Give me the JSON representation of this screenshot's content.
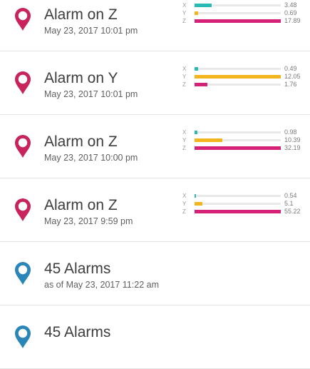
{
  "colors": {
    "alarm_pin": "#c8245a",
    "summary_pin": "#2a86b8",
    "x_bar": "#2ab9b5",
    "y_bar": "#f2b51d",
    "z_bar": "#d62179",
    "track": "#e9e9e9"
  },
  "rows": [
    {
      "type": "alarm",
      "icon": "map-pin-icon",
      "title": "Alarm on Z",
      "timestamp": "May 23, 2017 10:01 pm",
      "axes": [
        {
          "label": "X",
          "value": "3.48",
          "fill": 0.2
        },
        {
          "label": "Y",
          "value": "0.69",
          "fill": 0.04
        },
        {
          "label": "Z",
          "value": "17.89",
          "fill": 1.0
        }
      ]
    },
    {
      "type": "alarm",
      "icon": "map-pin-icon",
      "title": "Alarm on Y",
      "timestamp": "May 23, 2017 10:01 pm",
      "axes": [
        {
          "label": "X",
          "value": "0.49",
          "fill": 0.04
        },
        {
          "label": "Y",
          "value": "12.05",
          "fill": 1.0
        },
        {
          "label": "Z",
          "value": "1.76",
          "fill": 0.15
        }
      ]
    },
    {
      "type": "alarm",
      "icon": "map-pin-icon",
      "title": "Alarm on Z",
      "timestamp": "May 23, 2017 10:00 pm",
      "axes": [
        {
          "label": "X",
          "value": "0.98",
          "fill": 0.03
        },
        {
          "label": "Y",
          "value": "10.39",
          "fill": 0.32
        },
        {
          "label": "Z",
          "value": "32.19",
          "fill": 1.0
        }
      ]
    },
    {
      "type": "alarm",
      "icon": "map-pin-icon",
      "title": "Alarm on Z",
      "timestamp": "May 23, 2017 9:59 pm",
      "axes": [
        {
          "label": "X",
          "value": "0.54",
          "fill": 0.01
        },
        {
          "label": "Y",
          "value": "5.1",
          "fill": 0.09
        },
        {
          "label": "Z",
          "value": "55.22",
          "fill": 1.0
        }
      ]
    },
    {
      "type": "summary",
      "icon": "map-pin-icon",
      "title": "45 Alarms",
      "timestamp": "as of May 23, 2017 11:22 am"
    },
    {
      "type": "summary",
      "icon": "map-pin-icon",
      "title": "45 Alarms",
      "timestamp": ""
    }
  ]
}
